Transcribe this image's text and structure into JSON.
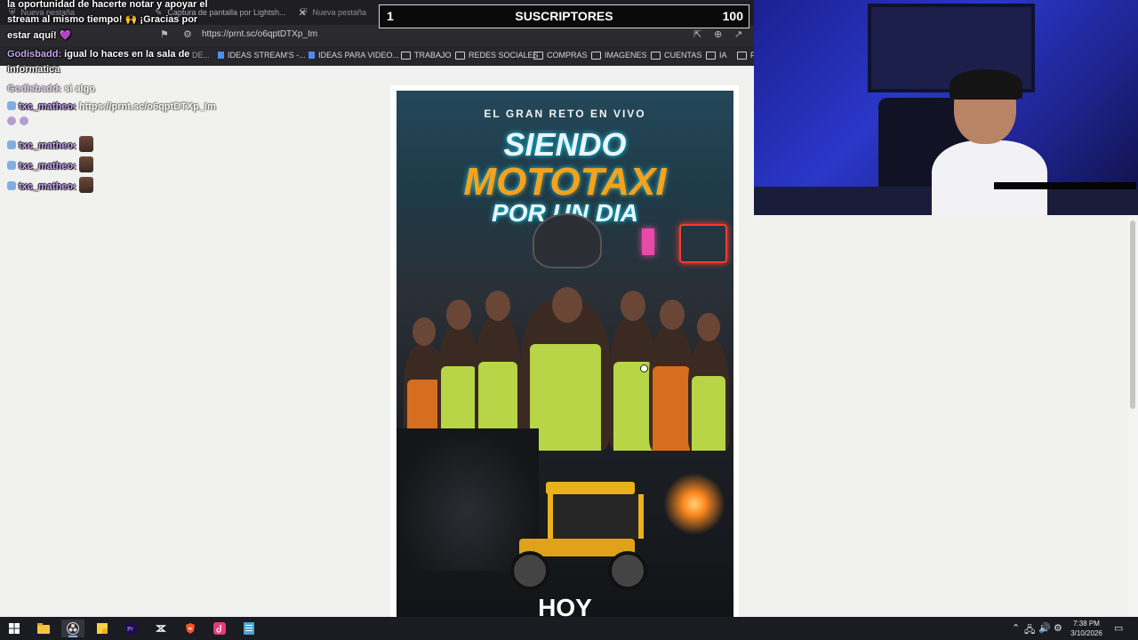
{
  "browser": {
    "tabs": [
      {
        "label": "Nueva pestaña",
        "active": false
      },
      {
        "label": "Captura de pantalla por Lightsh...",
        "active": true
      },
      {
        "label": "Nueva pestaña",
        "active": false
      }
    ],
    "new_tab_symbol": "+",
    "url": "https://prnt.sc/o6qptDTXp_Im",
    "bookmarks": [
      {
        "label": "IDEAS STREAM'S -...",
        "icon": "doc-icon"
      },
      {
        "label": "IDEAS PARA VIDEO...",
        "icon": "doc-icon"
      },
      {
        "label": "TRABAJO",
        "icon": "folder-icon"
      },
      {
        "label": "REDES SOCIALES",
        "icon": "folder-icon"
      },
      {
        "label": "COMPRAS",
        "icon": "folder-icon"
      },
      {
        "label": "IMAGENES",
        "icon": "folder-icon"
      },
      {
        "label": "CUENTAS",
        "icon": "folder-icon"
      },
      {
        "label": "IA",
        "icon": "folder-icon"
      },
      {
        "label": "F",
        "icon": "folder-icon"
      }
    ],
    "bookmark_hidden_fragment": "DE..."
  },
  "subscriber_bar": {
    "current": "1",
    "label": "SUSCRIPTORES",
    "goal": "100"
  },
  "chat": {
    "alert_line1": "la oportunidad de hacerte notar y apoyar el",
    "alert_line2": "stream al mismo tiempo! 🙌 ¡Gracias por",
    "alert_line3": "estar aquí! 💜",
    "msg1_user": "Godisbadd:",
    "msg1_text_line1": "igual lo haces en la sala de",
    "msg1_text_line2": "informatica",
    "msg2_user": "Godisbadd:",
    "msg2_text": "si algo",
    "msg3_user": "txc_matheo:",
    "msg3_text": "https://prnt.sc/o6qptDTXp_Im",
    "msg4_user": "txc_matheo:",
    "msg5_user": "txc_matheo:",
    "msg6_user": "txc_matheo:"
  },
  "poster": {
    "kicker": "EL GRAN RETO EN VIVO",
    "title_line1": "SIENDO",
    "title_line2": "MOTOTAXI",
    "title_line3": "POR UN DIA",
    "footer": "HOY"
  },
  "taskbar": {
    "apps": [
      "windows-start-icon",
      "file-explorer-icon",
      "obs-icon",
      "sticky-notes-icon",
      "premiere-pro-icon",
      "capcut-icon",
      "brave-icon",
      "tiktok-icon",
      "notepad-icon"
    ],
    "time": "7:38 PM",
    "date": "3/10/2026"
  },
  "colors": {
    "accent_user": "#c9a7f2",
    "webcam_light": "#2a37c8",
    "poster_orange": "#f7a21b",
    "poster_cyan": "#22d3ee"
  }
}
